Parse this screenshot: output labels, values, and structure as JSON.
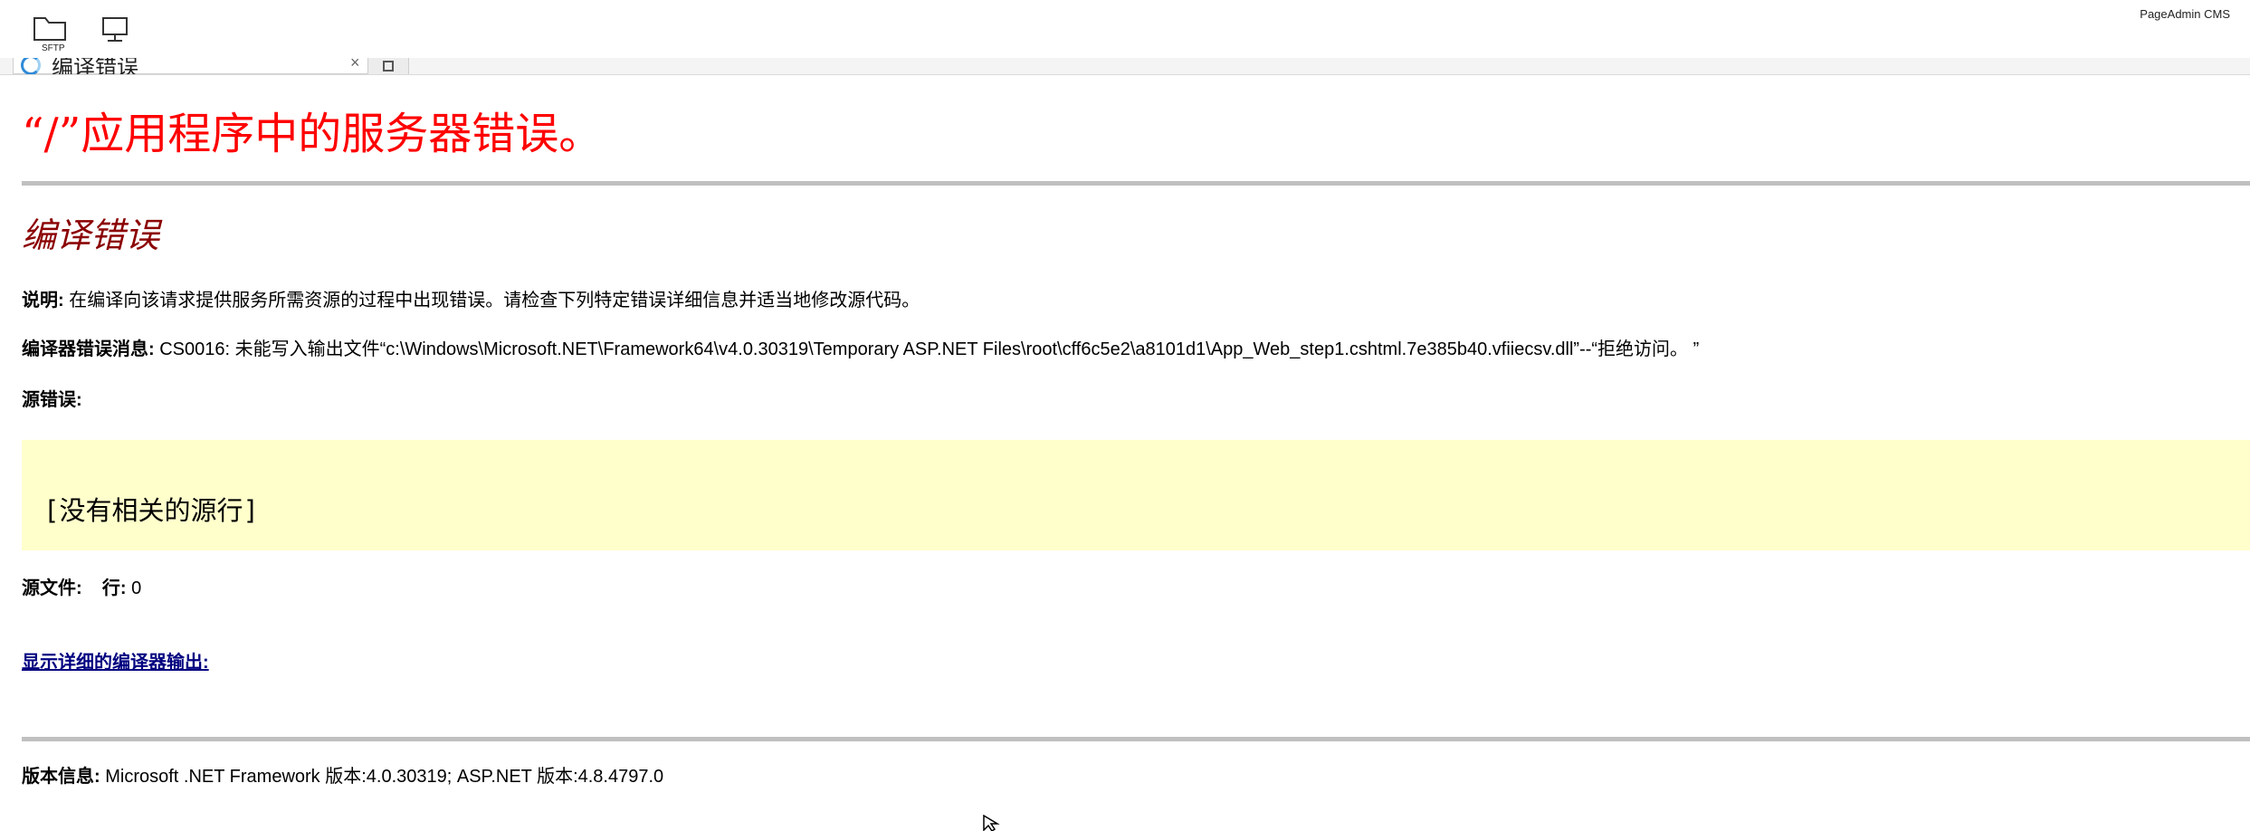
{
  "toolbar": {
    "sftp_label": "SFTP",
    "app_name": "PageAdmin CMS"
  },
  "tab": {
    "title": "编译错误",
    "close": "×"
  },
  "page": {
    "heading": "“/”应用程序中的服务器错误。",
    "subheading": "编译错误",
    "description_label": "说明:",
    "description_text": "在编译向该请求提供服务所需资源的过程中出现错误。请检查下列特定错误详细信息并适当地修改源代码。",
    "compiler_msg_label": "编译器错误消息:",
    "compiler_msg_text": "CS0016: 未能写入输出文件“c:\\Windows\\Microsoft.NET\\Framework64\\v4.0.30319\\Temporary ASP.NET Files\\root\\cff6c5e2\\a8101d1\\App_Web_step1.cshtml.7e385b40.vfiiecsv.dll”--“拒绝访问。 ”",
    "source_error_label": "源错误:",
    "source_code": "[没有相关的源行]",
    "source_file_label": "源文件:",
    "line_label": "行:",
    "line_value": "0",
    "detail_link": "显示详细的编译器输出:",
    "version_label": "版本信息:",
    "version_text": "Microsoft .NET Framework 版本:4.0.30319; ASP.NET 版本:4.8.4797.0"
  },
  "colors": {
    "heading": "#ff0000",
    "subheading": "#8b0000",
    "code_bg": "#ffffcc",
    "rule": "#c0c0c0",
    "link": "#000080"
  }
}
